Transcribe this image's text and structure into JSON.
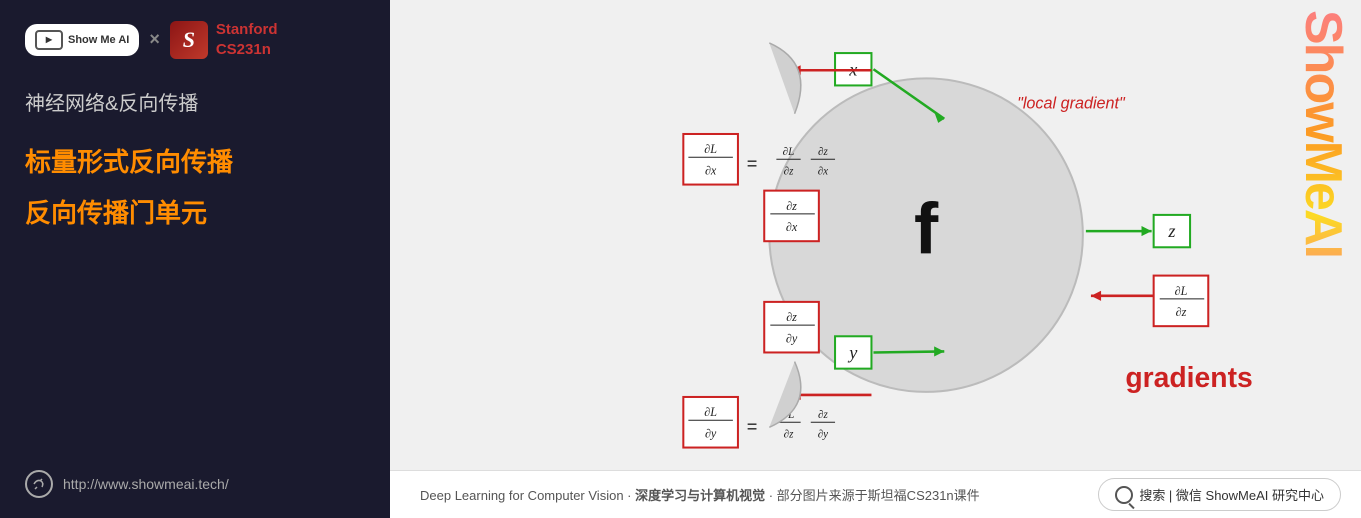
{
  "left": {
    "logo_showmeai": "Show Me AI",
    "logo_showmeai_subtext": "ShowMeAI",
    "x_separator": "×",
    "stanford_letter": "S",
    "stanford_name": "Stanford",
    "stanford_course": "CS231n",
    "subtitle": "神经网络&反向传播",
    "highlight1": "标量形式反向传播",
    "highlight2": "反向传播门单元",
    "website": "http://www.showmeai.tech/"
  },
  "diagram": {
    "local_gradient_label": "\"local gradient\"",
    "gradients_label": "gradients",
    "f_label": "f",
    "x_var": "x",
    "y_var": "y",
    "z_var": "z"
  },
  "bottom": {
    "caption_left": "Deep Learning for Computer Vision · ",
    "caption_bold": "深度学习与计算机视觉",
    "caption_right": " · 部分图片来源于斯坦福CS231n课件",
    "search_text": "搜索 | 微信  ShowMeAI 研究中心"
  },
  "watermark": {
    "text": "ShowMeAI"
  }
}
